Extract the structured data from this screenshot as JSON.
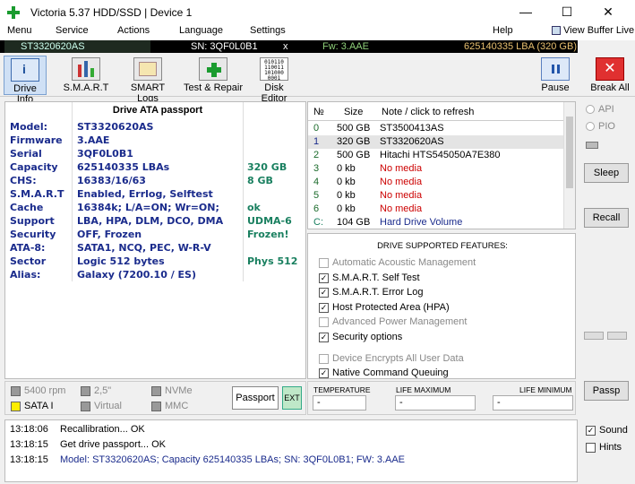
{
  "window": {
    "title": "Victoria 5.37 HDD/SSD | Device 1",
    "minimize": "—",
    "maximize": "☐",
    "close": "✕"
  },
  "menu": [
    "Menu",
    "Service",
    "Actions",
    "Language",
    "Settings",
    "Help"
  ],
  "view_buffer": "View Buffer Live",
  "infobar": {
    "model": "ST3320620AS",
    "serial": "SN: 3QF0L0B1",
    "close": "x",
    "firmware": "Fw: 3.AAE",
    "lba": "625140335 LBA (320 GB)"
  },
  "toolbar": [
    "Drive Info",
    "S.M.A.R.T",
    "SMART Logs",
    "Test & Repair",
    "Disk Editor",
    "Pause",
    "Break All"
  ],
  "passport": {
    "header": "Drive ATA passport",
    "rows": [
      {
        "label": "Model:",
        "value": "ST3320620AS",
        "extra": ""
      },
      {
        "label": "Firmware",
        "value": "3.AAE",
        "extra": ""
      },
      {
        "label": "Serial",
        "value": "3QF0L0B1",
        "extra": ""
      },
      {
        "label": "Capacity",
        "value": "625140335 LBAs",
        "extra": "320 GB"
      },
      {
        "label": "CHS:",
        "value": "16383/16/63",
        "extra": "8 GB"
      },
      {
        "label": "S.M.A.R.T",
        "value": "Enabled, Errlog, Selftest",
        "extra": ""
      },
      {
        "label": "Cache",
        "value": "16384k; L/A=ON; Wr=ON;",
        "extra": "ok"
      },
      {
        "label": "Support",
        "value": "LBA, HPA, DLM, DCO, DMA",
        "extra": "UDMA-6"
      },
      {
        "label": "Security",
        "value": "OFF, Frozen",
        "extra": "Frozen!"
      },
      {
        "label": "ATA-8:",
        "value": "SATA1, NCQ, PEC, W-R-V",
        "extra": ""
      },
      {
        "label": "Sector",
        "value": "Logic 512 bytes",
        "extra": "Phys 512"
      },
      {
        "label": "Alias:",
        "value": "Galaxy (7200.10 / ES)",
        "extra": ""
      }
    ]
  },
  "drive_list": {
    "headers": [
      "№",
      "Size",
      "Note / click to refresh"
    ],
    "rows": [
      {
        "n": "0",
        "size": "500 GB",
        "note": "ST3500413AS"
      },
      {
        "n": "1",
        "size": "320 GB",
        "note": "ST3320620AS"
      },
      {
        "n": "2",
        "size": "500 GB",
        "note": "Hitachi HTS545050A7E380"
      },
      {
        "n": "3",
        "size": "0 kb",
        "note": "No media"
      },
      {
        "n": "4",
        "size": "0 kb",
        "note": "No media"
      },
      {
        "n": "5",
        "size": "0 kb",
        "note": "No media"
      },
      {
        "n": "6",
        "size": "0 kb",
        "note": "No media"
      },
      {
        "n": "C:",
        "size": "104 GB",
        "note": "Hard Drive Volume"
      }
    ]
  },
  "features": {
    "header": "DRIVE SUPPORTED FEATURES:",
    "items": [
      {
        "label": "Automatic Acoustic Management",
        "checked": false,
        "enabled": false
      },
      {
        "label": "S.M.A.R.T. Self Test",
        "checked": true,
        "enabled": true
      },
      {
        "label": "S.M.A.R.T. Error Log",
        "checked": true,
        "enabled": true
      },
      {
        "label": "Host Protected Area (HPA)",
        "checked": true,
        "enabled": true
      },
      {
        "label": "Advanced Power Management",
        "checked": false,
        "enabled": false
      },
      {
        "label": "Security options",
        "checked": true,
        "enabled": true
      },
      {
        "label": "Device Encrypts All User Data",
        "checked": false,
        "enabled": false
      },
      {
        "label": "Native Command Queuing",
        "checked": true,
        "enabled": true
      }
    ]
  },
  "right": {
    "api": "API",
    "pio": "PIO",
    "sleep": "Sleep",
    "recall": "Recall",
    "passp": "Passp"
  },
  "bottom_left": {
    "rpm": "5400 rpm",
    "size": "2,5\"",
    "nvme": "NVMe",
    "sata": "SATA I",
    "virtual": "Virtual",
    "mmc": "MMC",
    "passport_btn": "Passport",
    "ext_btn": "EXT"
  },
  "bottom_mid": {
    "temperature": "TEMPERATURE",
    "life_max": "LIFE MAXIMUM",
    "life_min": "LIFE MINIMUM",
    "dash": "-"
  },
  "log": [
    {
      "time": "13:18:06",
      "msg": "Recallibration... OK",
      "color": "#000"
    },
    {
      "time": "13:18:15",
      "msg": "Get drive passport... OK",
      "color": "#000"
    },
    {
      "time": "13:18:15",
      "msg": "Model: ST3320620AS; Capacity 625140335 LBAs; SN: 3QF0L0B1; FW: 3.AAE",
      "color": "#1a2b8c"
    }
  ],
  "sound": "Sound",
  "hints": "Hints"
}
